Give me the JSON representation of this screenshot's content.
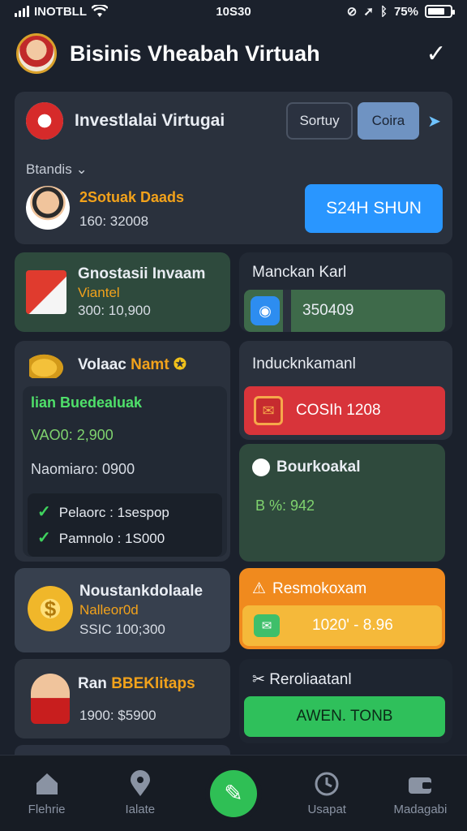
{
  "status_bar": {
    "carrier": "INOTBLL",
    "time": "10S30",
    "battery": "75%",
    "battery_level": 0.75
  },
  "header": {
    "title": "Bisinis Vheabah Virtuah"
  },
  "hero": {
    "title": "Investlalai Virtugai",
    "sort_label": "Sortuy",
    "coin_label": "Coira",
    "section_label": "Btandis",
    "name": "2Sotuak Daads",
    "value": "160: 32008",
    "action_label": "S24H SHUN"
  },
  "gnost": {
    "title": "Gnostasii Invaam",
    "subtitle": "Viantel",
    "value": "300: 10,900"
  },
  "manc": {
    "title": "Manckan Karl",
    "value": "350409"
  },
  "volaac": {
    "title_a": "Volaac",
    "title_b": "Namt",
    "green_text": "lian Buedealuak",
    "line2": "VAO0: 2,900",
    "line3": "Naomiaro: 0900",
    "items": [
      {
        "label": "Pelaorc : 1sespop"
      },
      {
        "label": "Pamnolo : 1S000"
      }
    ]
  },
  "invd": {
    "title": "Inducknkamanl",
    "value": "COSIh 1208"
  },
  "bourk": {
    "title": "Bourkoakal",
    "value": "B %: 942"
  },
  "noust": {
    "title": "Noustankdolaale",
    "subtitle": "Nalleor0d",
    "value": "SSIC 100;300"
  },
  "resm": {
    "title": "Resmokoxam",
    "value": "1020' - 8.96"
  },
  "ran": {
    "title_a": "Ran",
    "title_b": "BBEKlitaps",
    "value": "1900: $5900"
  },
  "relon": {
    "title": "Reroliaatanl",
    "button": "AWEN. TONB"
  },
  "bottom_nav": {
    "items": [
      {
        "label": "Flehrie",
        "icon": "home-icon"
      },
      {
        "label": "Ialate",
        "icon": "location-pin-icon"
      },
      {
        "label": "",
        "icon": "pen-icon"
      },
      {
        "label": "Usapat",
        "icon": "clock-icon"
      },
      {
        "label": "Madagabi",
        "icon": "wallet-icon"
      }
    ]
  },
  "colors": {
    "accent_orange": "#f2a21b",
    "primary_blue": "#2996ff",
    "green": "#2fbf55",
    "red": "#d8343a"
  }
}
